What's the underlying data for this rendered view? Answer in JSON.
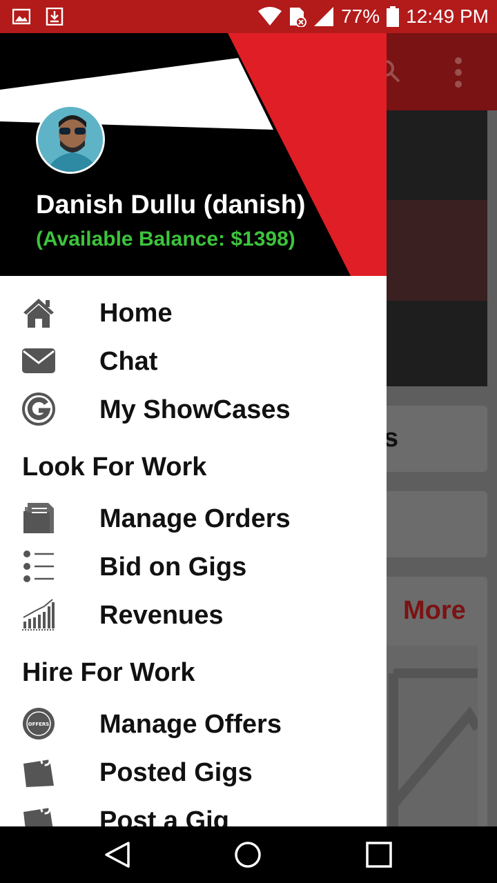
{
  "status_bar": {
    "battery": "77%",
    "time": "12:49 PM",
    "icons": [
      "image-icon",
      "download-icon",
      "wifi-icon",
      "sim-alert-icon",
      "signal-icon",
      "battery-icon"
    ]
  },
  "background": {
    "partial_title_fragment": "s",
    "more_label": "More",
    "icons": [
      "search-icon",
      "overflow-menu-icon"
    ]
  },
  "drawer": {
    "user": {
      "name": "Danish Dullu (danish)",
      "balance": "(Available Balance: $1398)"
    },
    "colors": {
      "accent": "#e01e26",
      "balance": "#3cc43c",
      "header_bg": "#000000"
    },
    "items_main": [
      {
        "label": "Home",
        "icon": "home-icon"
      },
      {
        "label": "Chat",
        "icon": "envelope-icon"
      },
      {
        "label": "My ShowCases",
        "icon": "showcase-g-icon"
      }
    ],
    "section_work": {
      "title": "Look For Work",
      "items": [
        {
          "label": "Manage Orders",
          "icon": "orders-icon"
        },
        {
          "label": "Bid on Gigs",
          "icon": "list-icon"
        },
        {
          "label": "Revenues",
          "icon": "chart-icon"
        }
      ]
    },
    "section_hire": {
      "title": "Hire For Work",
      "items": [
        {
          "label": "Manage Offers",
          "icon": "offers-badge-icon"
        },
        {
          "label": "Posted Gigs",
          "icon": "pinned-note-icon"
        },
        {
          "label": "Post a Gig",
          "icon": "pinned-note-icon"
        }
      ]
    }
  },
  "nav_bar": {
    "icons": [
      "back-icon",
      "home-circle-icon",
      "recents-icon"
    ]
  }
}
